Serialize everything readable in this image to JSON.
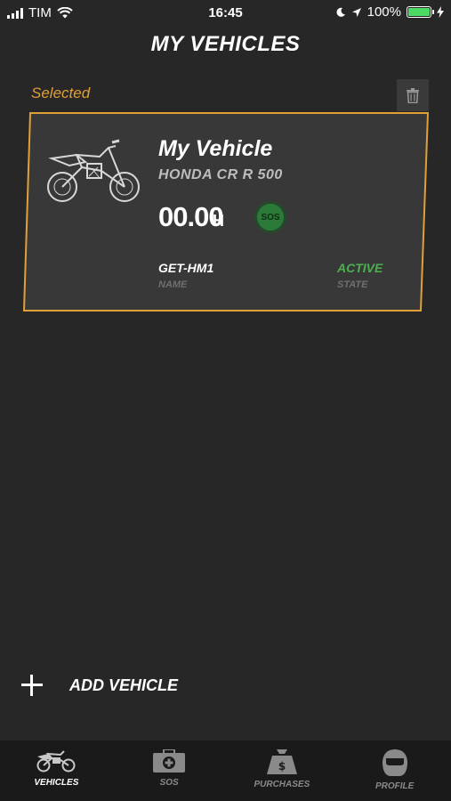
{
  "status_bar": {
    "carrier": "TIM",
    "time": "16:45",
    "battery": "100%"
  },
  "header": {
    "title": "MY VEHICLES"
  },
  "selected_label": "Selected",
  "vehicle": {
    "name": "My Vehicle",
    "model": "HONDA CR R 500",
    "hours": "00.00",
    "hours_unit": "H",
    "sos_badge": "SOS",
    "name_value": "GET-HM1",
    "name_label": "NAME",
    "state_value": "ACTIVE",
    "state_label": "STATE"
  },
  "add_vehicle_label": "ADD VEHICLE",
  "tabs": [
    {
      "label": "VEHICLES",
      "icon": "motorcycle-icon",
      "active": true
    },
    {
      "label": "SOS",
      "icon": "first-aid-kit-icon",
      "active": false
    },
    {
      "label": "PURCHASES",
      "icon": "money-bag-icon",
      "active": false
    },
    {
      "label": "PROFILE",
      "icon": "helmet-icon",
      "active": false
    }
  ],
  "colors": {
    "accent": "#e0a037",
    "active_green": "#4caf50",
    "background": "#272727",
    "card": "#383838"
  }
}
